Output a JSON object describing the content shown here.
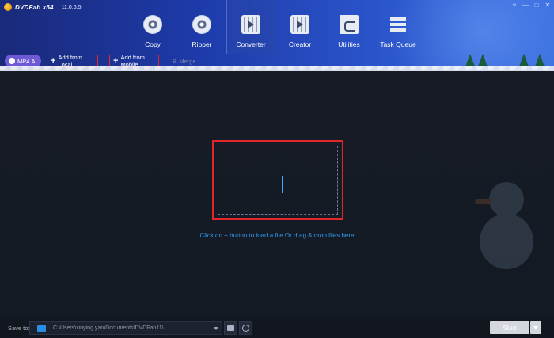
{
  "app": {
    "name": "DVDFab x64",
    "version": "11.0.6.5"
  },
  "window_controls": [
    "▿",
    "—",
    "□",
    "✕"
  ],
  "nav": [
    {
      "label": "Copy",
      "icon": "disc-copy-icon",
      "active": false
    },
    {
      "label": "Ripper",
      "icon": "disc-ripper-icon",
      "active": false
    },
    {
      "label": "Converter",
      "icon": "film-converter-icon",
      "active": true
    },
    {
      "label": "Creator",
      "icon": "film-creator-icon",
      "active": false
    },
    {
      "label": "Utilities",
      "icon": "utilities-icon",
      "active": false
    },
    {
      "label": "Task Queue",
      "icon": "task-queue-icon",
      "active": false
    }
  ],
  "toolbar": {
    "mp4ai": "MP4.AI",
    "add_local": "Add from Local",
    "add_mobile": "Add from Mobile",
    "merge": "Merge"
  },
  "main": {
    "hint": "Click on + button to load a file Or drag & drop files here"
  },
  "footer": {
    "save_to_label": "Save to:",
    "path": "C:\\Users\\xiuying.yan\\Documents\\DVDFab11\\",
    "start_label": "Start"
  },
  "colors": {
    "accent_blue": "#2f9df0",
    "highlight_red": "#e3262a",
    "mp4ai_purple": "#6f5ad6"
  }
}
